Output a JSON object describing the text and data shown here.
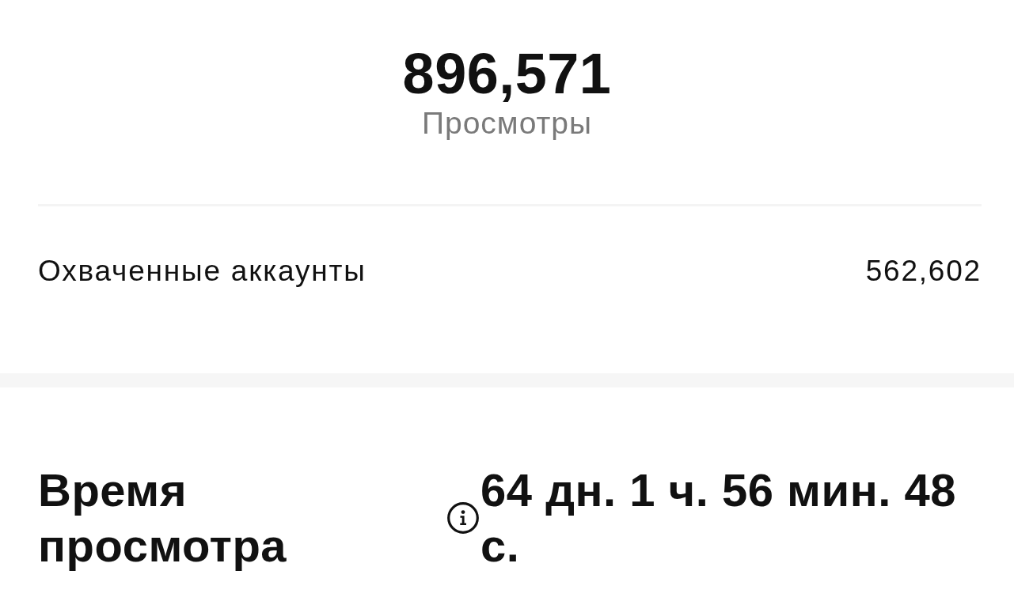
{
  "summary": {
    "value": "896,571",
    "label": "Просмотры"
  },
  "metrics": [
    {
      "label": "Охваченные аккаунты",
      "value": "562,602"
    }
  ],
  "watch_time": {
    "label": "Время просмотра",
    "value": "64 дн. 1 ч. 56 мин. 48 с."
  }
}
